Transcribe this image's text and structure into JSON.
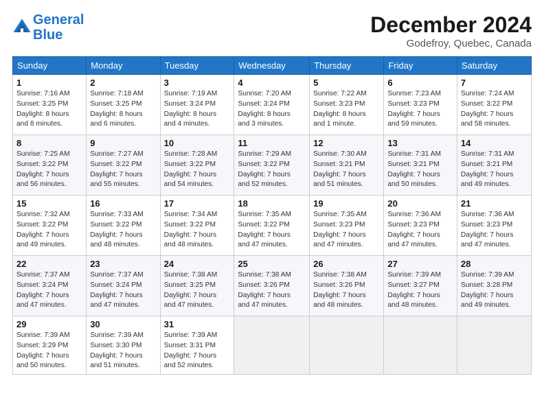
{
  "header": {
    "logo_line1": "General",
    "logo_line2": "Blue",
    "month_year": "December 2024",
    "location": "Godefroy, Quebec, Canada"
  },
  "weekdays": [
    "Sunday",
    "Monday",
    "Tuesday",
    "Wednesday",
    "Thursday",
    "Friday",
    "Saturday"
  ],
  "weeks": [
    [
      {
        "day": "1",
        "info": "Sunrise: 7:16 AM\nSunset: 3:25 PM\nDaylight: 8 hours\nand 8 minutes."
      },
      {
        "day": "2",
        "info": "Sunrise: 7:18 AM\nSunset: 3:25 PM\nDaylight: 8 hours\nand 6 minutes."
      },
      {
        "day": "3",
        "info": "Sunrise: 7:19 AM\nSunset: 3:24 PM\nDaylight: 8 hours\nand 4 minutes."
      },
      {
        "day": "4",
        "info": "Sunrise: 7:20 AM\nSunset: 3:24 PM\nDaylight: 8 hours\nand 3 minutes."
      },
      {
        "day": "5",
        "info": "Sunrise: 7:22 AM\nSunset: 3:23 PM\nDaylight: 8 hours\nand 1 minute."
      },
      {
        "day": "6",
        "info": "Sunrise: 7:23 AM\nSunset: 3:23 PM\nDaylight: 7 hours\nand 59 minutes."
      },
      {
        "day": "7",
        "info": "Sunrise: 7:24 AM\nSunset: 3:22 PM\nDaylight: 7 hours\nand 58 minutes."
      }
    ],
    [
      {
        "day": "8",
        "info": "Sunrise: 7:25 AM\nSunset: 3:22 PM\nDaylight: 7 hours\nand 56 minutes."
      },
      {
        "day": "9",
        "info": "Sunrise: 7:27 AM\nSunset: 3:22 PM\nDaylight: 7 hours\nand 55 minutes."
      },
      {
        "day": "10",
        "info": "Sunrise: 7:28 AM\nSunset: 3:22 PM\nDaylight: 7 hours\nand 54 minutes."
      },
      {
        "day": "11",
        "info": "Sunrise: 7:29 AM\nSunset: 3:22 PM\nDaylight: 7 hours\nand 52 minutes."
      },
      {
        "day": "12",
        "info": "Sunrise: 7:30 AM\nSunset: 3:21 PM\nDaylight: 7 hours\nand 51 minutes."
      },
      {
        "day": "13",
        "info": "Sunrise: 7:31 AM\nSunset: 3:21 PM\nDaylight: 7 hours\nand 50 minutes."
      },
      {
        "day": "14",
        "info": "Sunrise: 7:31 AM\nSunset: 3:21 PM\nDaylight: 7 hours\nand 49 minutes."
      }
    ],
    [
      {
        "day": "15",
        "info": "Sunrise: 7:32 AM\nSunset: 3:22 PM\nDaylight: 7 hours\nand 49 minutes."
      },
      {
        "day": "16",
        "info": "Sunrise: 7:33 AM\nSunset: 3:22 PM\nDaylight: 7 hours\nand 48 minutes."
      },
      {
        "day": "17",
        "info": "Sunrise: 7:34 AM\nSunset: 3:22 PM\nDaylight: 7 hours\nand 48 minutes."
      },
      {
        "day": "18",
        "info": "Sunrise: 7:35 AM\nSunset: 3:22 PM\nDaylight: 7 hours\nand 47 minutes."
      },
      {
        "day": "19",
        "info": "Sunrise: 7:35 AM\nSunset: 3:23 PM\nDaylight: 7 hours\nand 47 minutes."
      },
      {
        "day": "20",
        "info": "Sunrise: 7:36 AM\nSunset: 3:23 PM\nDaylight: 7 hours\nand 47 minutes."
      },
      {
        "day": "21",
        "info": "Sunrise: 7:36 AM\nSunset: 3:23 PM\nDaylight: 7 hours\nand 47 minutes."
      }
    ],
    [
      {
        "day": "22",
        "info": "Sunrise: 7:37 AM\nSunset: 3:24 PM\nDaylight: 7 hours\nand 47 minutes."
      },
      {
        "day": "23",
        "info": "Sunrise: 7:37 AM\nSunset: 3:24 PM\nDaylight: 7 hours\nand 47 minutes."
      },
      {
        "day": "24",
        "info": "Sunrise: 7:38 AM\nSunset: 3:25 PM\nDaylight: 7 hours\nand 47 minutes."
      },
      {
        "day": "25",
        "info": "Sunrise: 7:38 AM\nSunset: 3:26 PM\nDaylight: 7 hours\nand 47 minutes."
      },
      {
        "day": "26",
        "info": "Sunrise: 7:38 AM\nSunset: 3:26 PM\nDaylight: 7 hours\nand 48 minutes."
      },
      {
        "day": "27",
        "info": "Sunrise: 7:39 AM\nSunset: 3:27 PM\nDaylight: 7 hours\nand 48 minutes."
      },
      {
        "day": "28",
        "info": "Sunrise: 7:39 AM\nSunset: 3:28 PM\nDaylight: 7 hours\nand 49 minutes."
      }
    ],
    [
      {
        "day": "29",
        "info": "Sunrise: 7:39 AM\nSunset: 3:29 PM\nDaylight: 7 hours\nand 50 minutes."
      },
      {
        "day": "30",
        "info": "Sunrise: 7:39 AM\nSunset: 3:30 PM\nDaylight: 7 hours\nand 51 minutes."
      },
      {
        "day": "31",
        "info": "Sunrise: 7:39 AM\nSunset: 3:31 PM\nDaylight: 7 hours\nand 52 minutes."
      },
      null,
      null,
      null,
      null
    ]
  ]
}
